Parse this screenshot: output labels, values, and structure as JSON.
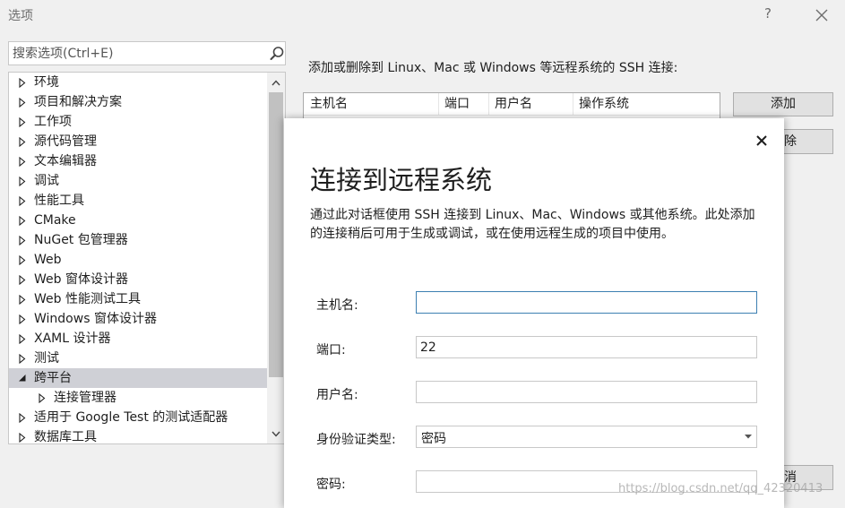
{
  "window": {
    "title": "选项",
    "help_label": "?"
  },
  "search": {
    "placeholder": "搜索选项(Ctrl+E)"
  },
  "tree": {
    "items": [
      {
        "label": "环境",
        "expanded": false
      },
      {
        "label": "项目和解决方案",
        "expanded": false
      },
      {
        "label": "工作项",
        "expanded": false
      },
      {
        "label": "源代码管理",
        "expanded": false
      },
      {
        "label": "文本编辑器",
        "expanded": false
      },
      {
        "label": "调试",
        "expanded": false
      },
      {
        "label": "性能工具",
        "expanded": false
      },
      {
        "label": "CMake",
        "expanded": false
      },
      {
        "label": "NuGet 包管理器",
        "expanded": false
      },
      {
        "label": "Web",
        "expanded": false
      },
      {
        "label": "Web 窗体设计器",
        "expanded": false
      },
      {
        "label": "Web 性能测试工具",
        "expanded": false
      },
      {
        "label": "Windows 窗体设计器",
        "expanded": false
      },
      {
        "label": "XAML 设计器",
        "expanded": false
      },
      {
        "label": "测试",
        "expanded": false
      },
      {
        "label": "跨平台",
        "expanded": true,
        "selected": true
      },
      {
        "label": "连接管理器",
        "expanded": false,
        "child": true
      },
      {
        "label": "适用于 Google Test 的测试适配器",
        "expanded": false
      },
      {
        "label": "数据库工具",
        "expanded": false
      }
    ]
  },
  "connections": {
    "label": "添加或删除到 Linux、Mac 或 Windows 等远程系统的 SSH 连接:",
    "columns": [
      "主机名",
      "端口",
      "用户名",
      "操作系统"
    ],
    "add_label": "添加",
    "remove_label": "除",
    "cancel_label": "消"
  },
  "dialog": {
    "title": "连接到远程系统",
    "description": "通过此对话框使用 SSH 连接到 Linux、Mac、Windows 或其他系统。此处添加的连接稍后可用于生成或调试，或在使用远程生成的项目中使用。",
    "fields": {
      "host": {
        "label": "主机名:",
        "value": ""
      },
      "port": {
        "label": "端口:",
        "value": "22"
      },
      "username": {
        "label": "用户名:",
        "value": ""
      },
      "auth": {
        "label": "身份验证类型:",
        "value": "密码"
      },
      "password": {
        "label": "密码:",
        "value": ""
      }
    }
  },
  "watermark": "https://blog.csdn.net/qq_42320413",
  "colors": {
    "selection": "#cfd0d6",
    "focus_border": "#3c7fb1",
    "background": "#f0f0f0"
  }
}
